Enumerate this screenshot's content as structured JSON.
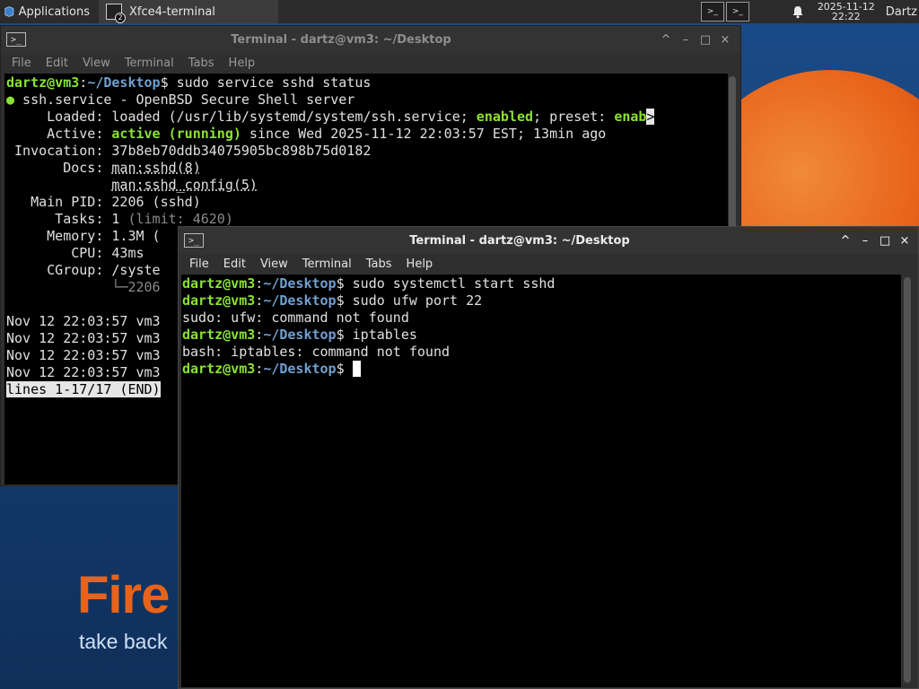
{
  "panel": {
    "applications_label": "Applications",
    "task_label": "Xfce4-terminal",
    "task_count": "2",
    "clock_date": "2025-11-12",
    "clock_time": "22:22",
    "user": "Dartz",
    "workspace_glyph": ">_"
  },
  "desktop": {
    "firefox_text": "Fire",
    "firefox_sub": "take back"
  },
  "windows": [
    {
      "title": "Terminal - dartz@vm3: ~/Desktop",
      "menu": [
        "File",
        "Edit",
        "View",
        "Terminal",
        "Tabs",
        "Help"
      ],
      "controls": [
        "^",
        "–",
        "□",
        "×"
      ],
      "lines": [
        [
          {
            "t": "dartz@vm3",
            "c": "u"
          },
          {
            "t": ":"
          },
          {
            "t": "~/Desktop",
            "c": "p"
          },
          {
            "t": "$ sudo service sshd status"
          }
        ],
        [
          {
            "t": "●",
            "c": "g"
          },
          {
            "t": " ssh.service - OpenBSD Secure Shell server"
          }
        ],
        [
          {
            "t": "     Loaded: loaded (/usr/lib/systemd/system/ssh.service; "
          },
          {
            "t": "enabled",
            "c": "gb"
          },
          {
            "t": "; preset: "
          },
          {
            "t": "enab",
            "c": "gb"
          },
          {
            "t": ">",
            "c": "inv"
          }
        ],
        [
          {
            "t": "     Active: "
          },
          {
            "t": "active (running)",
            "c": "gb"
          },
          {
            "t": " since Wed 2025-11-12 22:03:57 EST; 13min ago"
          }
        ],
        [
          {
            "t": " Invocation: 37b8eb70ddb34075905bc898b75d0182"
          }
        ],
        [
          {
            "t": "       Docs: "
          },
          {
            "t": "man:sshd(8)",
            "c": "ul"
          }
        ],
        [
          {
            "t": "             "
          },
          {
            "t": "man:sshd_config(5)",
            "c": "ul"
          }
        ],
        [
          {
            "t": "   Main PID: 2206 (sshd)"
          }
        ],
        [
          {
            "t": "      Tasks: 1 "
          },
          {
            "t": "(limit: 4620)",
            "c": "dim"
          }
        ],
        [
          {
            "t": "     Memory: 1.3M ("
          }
        ],
        [
          {
            "t": "        CPU: 43ms"
          }
        ],
        [
          {
            "t": "     CGroup: /syste"
          }
        ],
        [
          {
            "t": "             "
          },
          {
            "t": "└─",
            "c": "dim"
          },
          {
            "t": "2206",
            "c": "dim"
          }
        ],
        [
          {
            "t": ""
          }
        ],
        [
          {
            "t": "Nov 12 22:03:57 vm3"
          }
        ],
        [
          {
            "t": "Nov 12 22:03:57 vm3"
          }
        ],
        [
          {
            "t": "Nov 12 22:03:57 vm3"
          }
        ],
        [
          {
            "t": "Nov 12 22:03:57 vm3"
          }
        ],
        [
          {
            "t": "lines 1-17/17 (END)",
            "c": "inv"
          }
        ]
      ]
    },
    {
      "title": "Terminal - dartz@vm3: ~/Desktop",
      "menu": [
        "File",
        "Edit",
        "View",
        "Terminal",
        "Tabs",
        "Help"
      ],
      "controls": [
        "^",
        "–",
        "□",
        "×"
      ],
      "lines": [
        [
          {
            "t": "dartz@vm3",
            "c": "u"
          },
          {
            "t": ":"
          },
          {
            "t": "~/Desktop",
            "c": "p"
          },
          {
            "t": "$ sudo systemctl start sshd"
          }
        ],
        [
          {
            "t": "dartz@vm3",
            "c": "u"
          },
          {
            "t": ":"
          },
          {
            "t": "~/Desktop",
            "c": "p"
          },
          {
            "t": "$ sudo ufw port 22"
          }
        ],
        [
          {
            "t": "sudo: ufw: command not found"
          }
        ],
        [
          {
            "t": "dartz@vm3",
            "c": "u"
          },
          {
            "t": ":"
          },
          {
            "t": "~/Desktop",
            "c": "p"
          },
          {
            "t": "$ iptables"
          }
        ],
        [
          {
            "t": "bash: iptables: command not found"
          }
        ],
        [
          {
            "t": "dartz@vm3",
            "c": "u"
          },
          {
            "t": ":"
          },
          {
            "t": "~/Desktop",
            "c": "p"
          },
          {
            "t": "$ "
          },
          {
            "t": " ",
            "c": "cursor"
          }
        ]
      ]
    }
  ]
}
